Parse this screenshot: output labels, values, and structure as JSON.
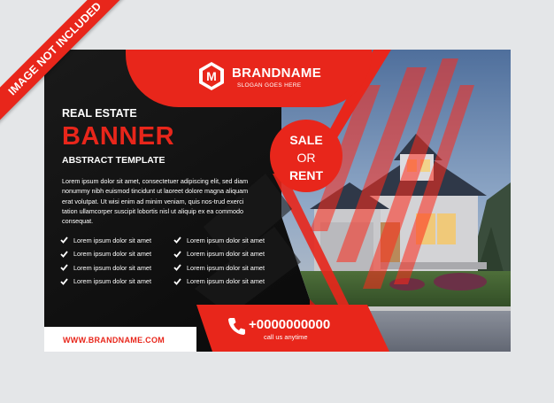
{
  "ribbon": {
    "text": "IMAGE NOT INCLUDED"
  },
  "brand": {
    "logo_letter": "M",
    "name": "BRANDNAME",
    "slogan": "SLOGAN GOES HERE"
  },
  "headline": {
    "kicker": "REAL ESTATE",
    "title": "BANNER",
    "subtitle": "ABSTRACT TEMPLATE"
  },
  "description": "Lorem ipsum dolor sit amet, consectetuer adipiscing elit, sed diam nonummy nibh euismod tincidunt ut laoreet dolore magna aliquam erat volutpat. Ut wisi enim ad minim veniam, quis nos-trud exerci tation ullamcorper suscipit lobortis nisl ut aliquip ex ea commodo consequat.",
  "checklist": [
    "Lorem ipsum dolor sit amet",
    "Lorem ipsum dolor sit amet",
    "Lorem ipsum dolor sit amet",
    "Lorem ipsum dolor sit amet",
    "Lorem ipsum dolor sit amet",
    "Lorem ipsum dolor sit amet",
    "Lorem ipsum dolor sit amet",
    "Lorem ipsum dolor sit amet"
  ],
  "badge": {
    "line1": "SALE",
    "line2": "OR",
    "line3": "RENT"
  },
  "contact": {
    "phone": "+0000000000",
    "call_text": "call us anytime",
    "website": "WWW.BRANDNAME.COM"
  },
  "icons": {
    "check": "check-icon",
    "phone": "phone-icon",
    "logo": "hexagon-logo-icon"
  },
  "colors": {
    "accent": "#e8261b",
    "dark": "#111111",
    "background": "#e4e6e8"
  }
}
